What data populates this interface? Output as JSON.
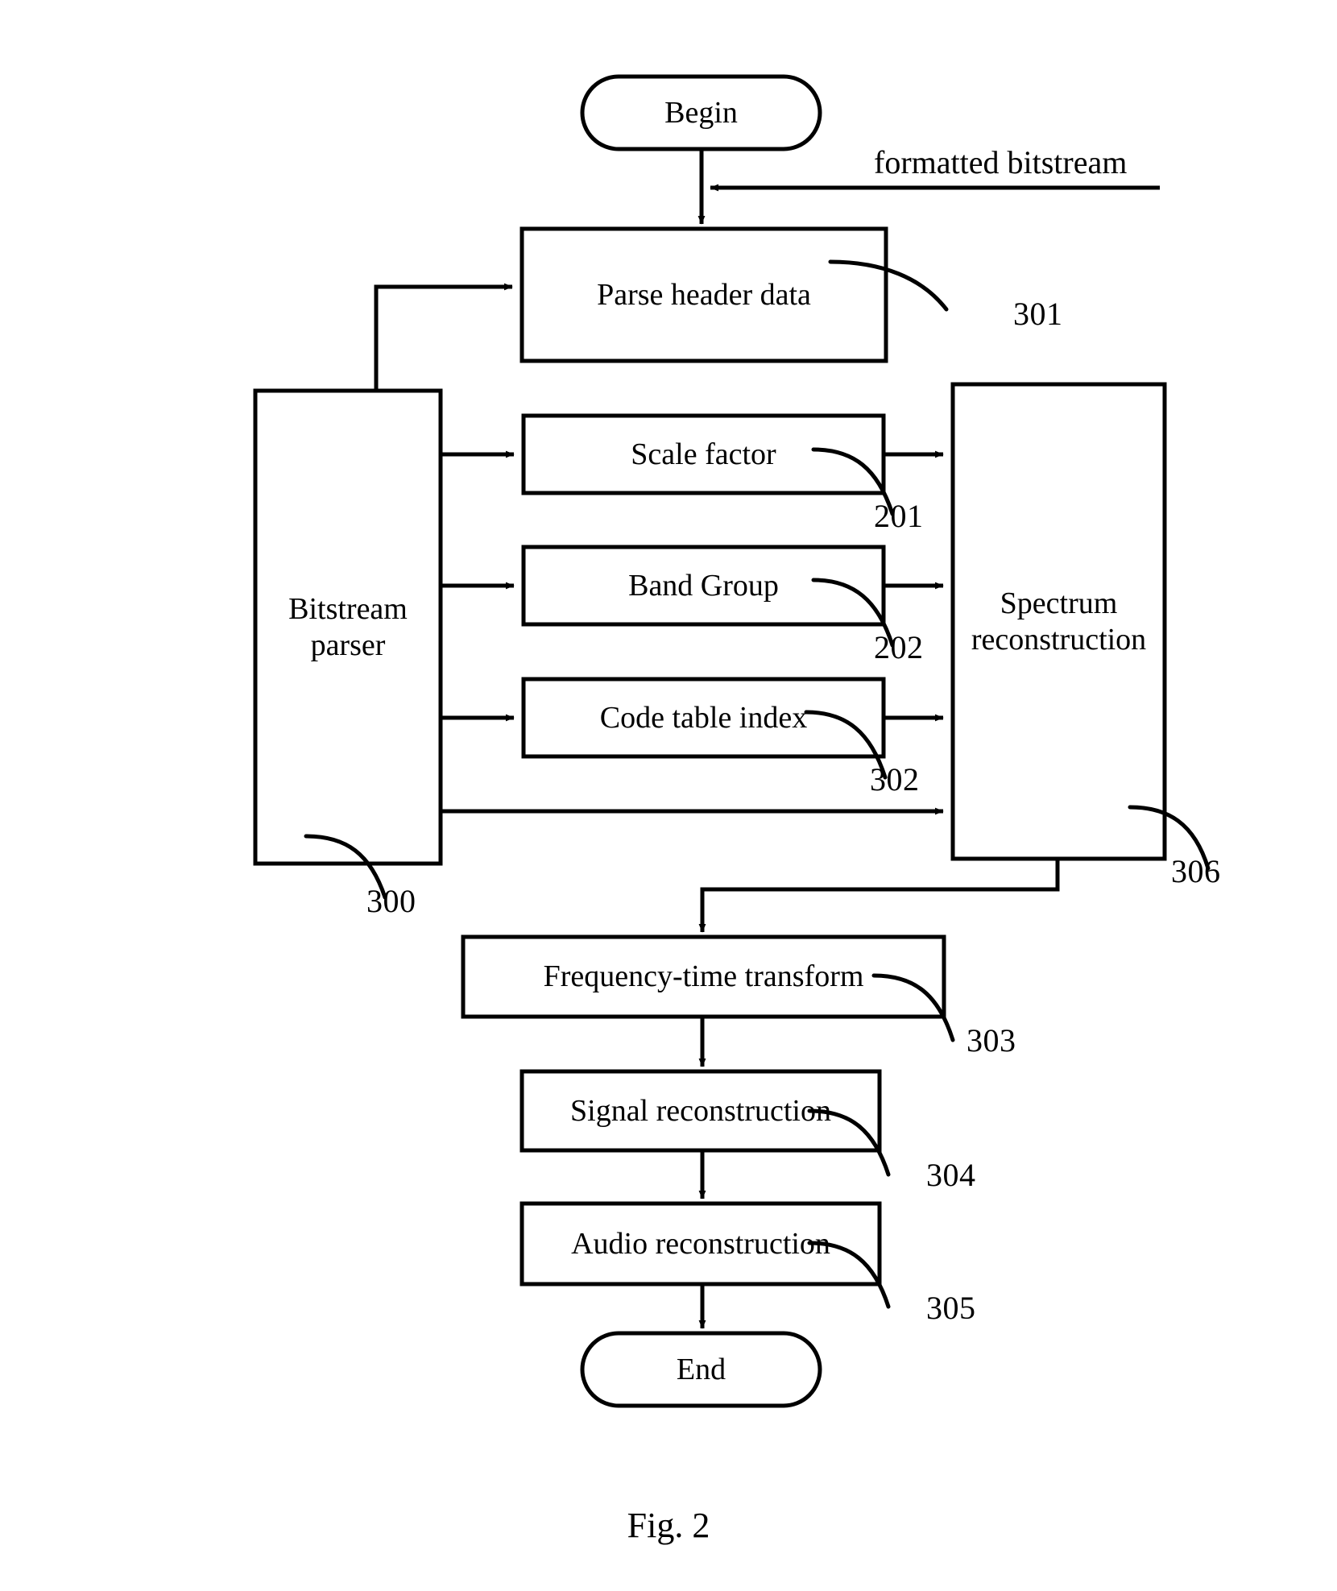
{
  "figure": {
    "caption": "Fig. 2"
  },
  "nodes": {
    "begin": {
      "label": "Begin",
      "shape": "terminator"
    },
    "parse_header": {
      "label": "Parse header data",
      "shape": "process",
      "ref": "301"
    },
    "bitstream_parser": {
      "label": "Bitstream\nparser",
      "shape": "process",
      "ref": "300"
    },
    "scale_factor": {
      "label": "Scale factor",
      "shape": "process",
      "ref": "201"
    },
    "band_group": {
      "label": "Band Group",
      "shape": "process",
      "ref": "202"
    },
    "code_table_index": {
      "label": "Code table index",
      "shape": "process",
      "ref": "302"
    },
    "spectrum_reconstruction": {
      "label": "Spectrum\nreconstruction",
      "shape": "process",
      "ref": "306"
    },
    "frequency_time_transform": {
      "label": "Frequency-time transform",
      "shape": "process",
      "ref": "303"
    },
    "signal_reconstruction": {
      "label": "Signal reconstruction",
      "shape": "process",
      "ref": "304"
    },
    "audio_reconstruction": {
      "label": "Audio reconstruction",
      "shape": "process",
      "ref": "305"
    },
    "end": {
      "label": "End",
      "shape": "terminator"
    }
  },
  "edges": {
    "formatted_bitstream_label": "formatted bitstream"
  },
  "reference_numerals": {
    "n201": "201",
    "n202": "202",
    "n300": "300",
    "n301": "301",
    "n302": "302",
    "n303": "303",
    "n304": "304",
    "n305": "305",
    "n306": "306"
  },
  "style": {
    "stroke": "#000000",
    "fill": "#ffffff",
    "background": "#ffffff"
  }
}
